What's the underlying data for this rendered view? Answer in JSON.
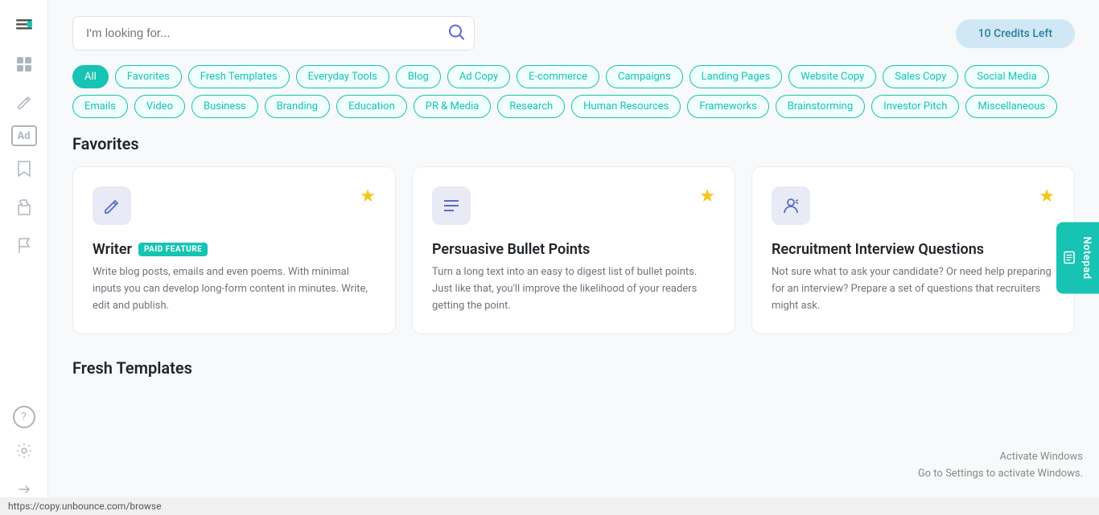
{
  "sidebar": {
    "icons": [
      {
        "name": "menu-icon",
        "symbol": "☰",
        "active": false
      },
      {
        "name": "layers-icon",
        "symbol": "⊞",
        "active": false
      },
      {
        "name": "edit-icon",
        "symbol": "✏️",
        "active": false
      },
      {
        "name": "ad-icon",
        "symbol": "Ad",
        "active": false
      },
      {
        "name": "bookmark-icon",
        "symbol": "🔖",
        "active": false
      },
      {
        "name": "puzzle-icon",
        "symbol": "🧩",
        "active": false
      },
      {
        "name": "flag-icon",
        "symbol": "⚑",
        "active": false
      },
      {
        "name": "help-icon",
        "symbol": "?",
        "active": false
      },
      {
        "name": "settings-icon",
        "symbol": "⚙",
        "active": false
      },
      {
        "name": "export-icon",
        "symbol": "→",
        "active": false
      }
    ]
  },
  "search": {
    "placeholder": "I'm looking for..."
  },
  "credits": {
    "label": "10 Credits Left"
  },
  "filters": {
    "tags": [
      {
        "label": "All",
        "active": true
      },
      {
        "label": "Favorites",
        "active": false
      },
      {
        "label": "Fresh Templates",
        "active": false
      },
      {
        "label": "Everyday Tools",
        "active": false
      },
      {
        "label": "Blog",
        "active": false
      },
      {
        "label": "Ad Copy",
        "active": false
      },
      {
        "label": "E-commerce",
        "active": false
      },
      {
        "label": "Campaigns",
        "active": false
      },
      {
        "label": "Landing Pages",
        "active": false
      },
      {
        "label": "Website Copy",
        "active": false
      },
      {
        "label": "Sales Copy",
        "active": false
      },
      {
        "label": "Social Media",
        "active": false
      },
      {
        "label": "Emails",
        "active": false
      },
      {
        "label": "Video",
        "active": false
      },
      {
        "label": "Business",
        "active": false
      },
      {
        "label": "Branding",
        "active": false
      },
      {
        "label": "Education",
        "active": false
      },
      {
        "label": "PR & Media",
        "active": false
      },
      {
        "label": "Research",
        "active": false
      },
      {
        "label": "Human Resources",
        "active": false
      },
      {
        "label": "Frameworks",
        "active": false
      },
      {
        "label": "Brainstorming",
        "active": false
      },
      {
        "label": "Investor Pitch",
        "active": false
      },
      {
        "label": "Miscellaneous",
        "active": false
      }
    ]
  },
  "favorites": {
    "section_title": "Favorites",
    "cards": [
      {
        "id": "writer",
        "title": "Writer",
        "paid": true,
        "paid_label": "PAID FEATURE",
        "description": "Write blog posts, emails and even poems. With minimal inputs you can develop long-form content in minutes. Write, edit and publish.",
        "starred": true,
        "icon": "✏️"
      },
      {
        "id": "persuasive-bullet-points",
        "title": "Persuasive Bullet Points",
        "paid": false,
        "description": "Turn a long text into an easy to digest list of bullet points. Just like that, you'll improve the likelihood of your readers getting the point.",
        "starred": true,
        "icon": "≡"
      },
      {
        "id": "recruitment-interview-questions",
        "title": "Recruitment Interview Questions",
        "paid": false,
        "description": "Not sure what to ask your candidate? Or need help preparing for an interview? Prepare a set of questions that recruiters might ask.",
        "starred": true,
        "icon": "👤"
      }
    ]
  },
  "fresh_templates": {
    "section_title": "Fresh Templates"
  },
  "notepad": {
    "label": "Notepad"
  },
  "status_bar": {
    "url": "https://copy.unbounce.com/browse"
  },
  "windows_watermark": {
    "line1": "Activate Windows",
    "line2": "Go to Settings to activate Windows."
  }
}
